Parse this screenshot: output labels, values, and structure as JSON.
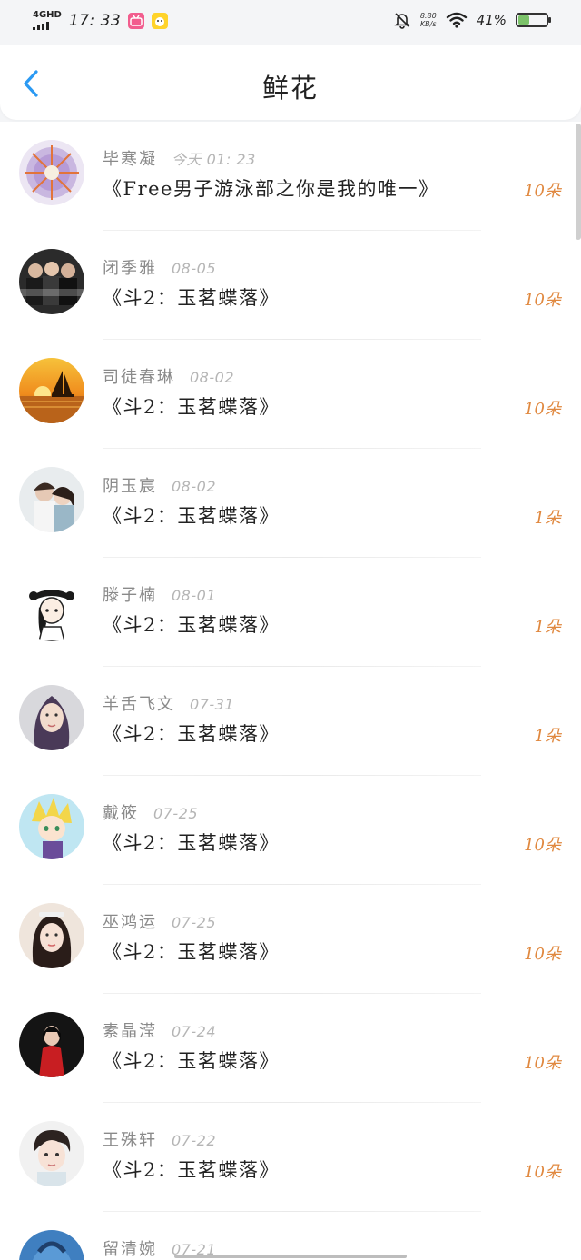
{
  "status_bar": {
    "network": "4GHD",
    "time": "17: 33",
    "app_icons": [
      "bilibili-icon",
      "comic-app-icon"
    ],
    "net_speed_value": "8.80",
    "net_speed_unit": "KB/s",
    "battery": "41%",
    "battery_level": 0.41
  },
  "header": {
    "title": "鲜花",
    "accent_color": "#2b9af3"
  },
  "count_color": "#e0883f",
  "items": [
    {
      "name": "毕寒凝",
      "date": "今天  01: 23",
      "book": "《Free男子游泳部之你是我的唯一》",
      "count": "10朵",
      "avatar": "avatar-pattern"
    },
    {
      "name": "闭季雅",
      "date": "08-05",
      "book": "《斗2：玉茗蝶落》",
      "count": "10朵",
      "avatar": "avatar-group-photo"
    },
    {
      "name": "司徒春琳",
      "date": "08-02",
      "book": "《斗2：玉茗蝶落》",
      "count": "10朵",
      "avatar": "avatar-sunset-sailboat"
    },
    {
      "name": "阴玉宸",
      "date": "08-02",
      "book": "《斗2：玉茗蝶落》",
      "count": "1朵",
      "avatar": "avatar-couple"
    },
    {
      "name": "滕子楠",
      "date": "08-01",
      "book": "《斗2：玉茗蝶落》",
      "count": "1朵",
      "avatar": "avatar-cartoon-girl"
    },
    {
      "name": "羊舌飞文",
      "date": "07-31",
      "book": "《斗2：玉茗蝶落》",
      "count": "1朵",
      "avatar": "avatar-woman-portrait"
    },
    {
      "name": "戴筱",
      "date": "07-25",
      "book": "《斗2：玉茗蝶落》",
      "count": "10朵",
      "avatar": "avatar-anime-blonde"
    },
    {
      "name": "巫鸿运",
      "date": "07-25",
      "book": "《斗2：玉茗蝶落》",
      "count": "10朵",
      "avatar": "avatar-woman-selfie"
    },
    {
      "name": "素晶滢",
      "date": "07-24",
      "book": "《斗2：玉茗蝶落》",
      "count": "10朵",
      "avatar": "avatar-red-dress"
    },
    {
      "name": "王殊轩",
      "date": "07-22",
      "book": "《斗2：玉茗蝶落》",
      "count": "10朵",
      "avatar": "avatar-young-man"
    },
    {
      "name": "留清婉",
      "date": "07-21",
      "book": "",
      "count": "",
      "avatar": "avatar-blue-cartoon"
    }
  ]
}
